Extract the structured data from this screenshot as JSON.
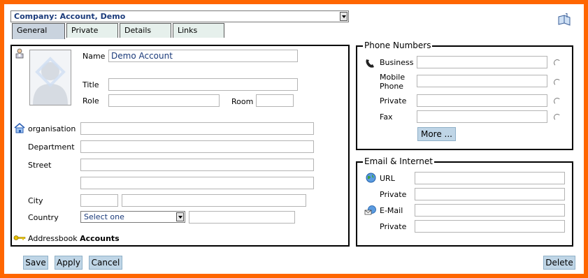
{
  "header": {
    "company_select_value": "Company: Account, Demo"
  },
  "tabs": [
    {
      "label": "General"
    },
    {
      "label": "Private"
    },
    {
      "label": "Details"
    },
    {
      "label": "Links"
    }
  ],
  "general": {
    "name_label": "Name",
    "name_value": "Demo Account",
    "title_label": "Title",
    "role_label": "Role",
    "room_label": "Room",
    "organisation_label": "organisation",
    "department_label": "Department",
    "street_label": "Street",
    "city_label": "City",
    "country_label": "Country",
    "country_select_value": "Select one",
    "addressbook_label": "Addressbook",
    "addressbook_value": "Accounts"
  },
  "phone": {
    "legend": "Phone Numbers",
    "business_label": "Business",
    "mobile_label": "Mobile Phone",
    "private_label": "Private",
    "fax_label": "Fax",
    "more_button": "More ..."
  },
  "email": {
    "legend": "Email & Internet",
    "url_label": "URL",
    "url_private_label": "Private",
    "email_label": "E-Mail",
    "email_private_label": "Private"
  },
  "buttons": {
    "save": "Save",
    "apply": "Apply",
    "cancel": "Cancel",
    "delete": "Delete"
  },
  "icons": {
    "help": "book-help-icon",
    "contact": "person-icon",
    "photo": "avatar-placeholder-icon",
    "org": "home-icon",
    "phone": "phone-icon",
    "globe": "globe-icon",
    "email": "email-icon",
    "key": "key-icon"
  }
}
